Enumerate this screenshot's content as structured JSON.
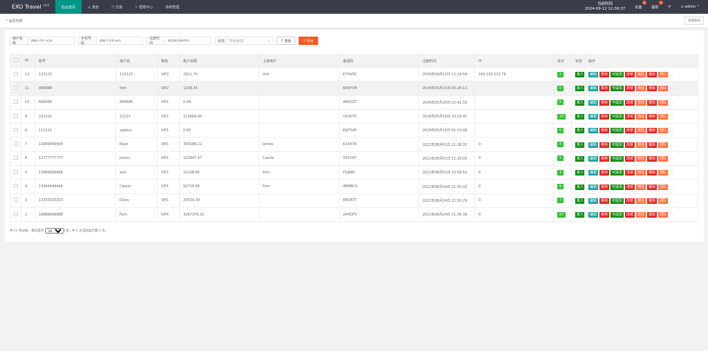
{
  "header": {
    "logo": "EXO Travel",
    "version": "v1.0",
    "nav": [
      "后台首页",
      "角色",
      "交易",
      "帮助中心",
      "系统管理"
    ],
    "time_label": "当前时间",
    "time": "2024-09-12 12:36:37",
    "recharge": "充值",
    "recharge_badge": "0",
    "withdraw": "提现",
    "withdraw_badge": "0",
    "user": "admin"
  },
  "breadcrumb": "会员列表",
  "add_member": "添加会员",
  "filters": {
    "username_label": "用户名称",
    "username_ph": "请输入用户名称",
    "phone_label": "手机号码",
    "phone_ph": "请输入手机号码",
    "reg_label": "注册时间",
    "reg_ph": "请选择注册时间",
    "status_label": "状态",
    "status_value": "所有状态",
    "search": "搜索",
    "export": "导出"
  },
  "columns": [
    "ID",
    "账号",
    "用户名",
    "等级",
    "账户余额",
    "上级用户",
    "邀请码",
    "注册时间",
    "ip",
    "单日",
    "状态",
    "操作"
  ],
  "actions": [
    "编辑",
    "禁用",
    "可提现",
    "改银",
    "地址",
    "删除",
    "团队",
    "..."
  ],
  "action_colors": [
    "#1e9fa0",
    "#e0201c",
    "#108b10",
    "#e0201c",
    "#ff6f3c",
    "#e0201c",
    "#ff6f3c"
  ],
  "status_text": "真人",
  "rows": [
    [
      "12",
      "123123",
      "123123",
      "VIP2",
      "2911.70",
      "ttttt",
      "E7HVRC",
      "2024年09月12日 12:24:54",
      "169.150.222.76",
      "2"
    ],
    [
      "11",
      "888888",
      "ttttt",
      "VIP2",
      "1238.34",
      "",
      "BX9YVN",
      "2024年05月21日 00:28:11",
      "",
      "0"
    ],
    [
      "10",
      "666666",
      "666666",
      "VIP1",
      "0.00",
      "",
      "ABVGZT",
      "2024年05月20日 02:42:32",
      "",
      "0"
    ],
    [
      "9",
      "222222",
      "22222",
      "VIP1",
      "115869.00",
      "",
      "U53XTK",
      "2024年05月19日 23:16:41",
      "",
      "29"
    ],
    [
      "8",
      "111111",
      "aabbcc",
      "VIP1",
      "0.00",
      "",
      "EJDTUM",
      "2024年05月19日 01:15:09",
      "",
      "0"
    ],
    [
      "7",
      "13999999999",
      "Ryan",
      "VIP1",
      "305088.22",
      "James",
      "K3X47A",
      "2022年08月01日 11:28:35",
      "0",
      "4"
    ],
    [
      "6",
      "13777777777",
      "James",
      "VIP1",
      "102847.47",
      "Cassie",
      "V553A7",
      "2022年08月01日 11:25:05",
      "0",
      "5"
    ],
    [
      "5",
      "13666666666",
      "ailsi",
      "VIP1",
      "10108.83",
      "Fern",
      "FDJ68C",
      "2022年08月01日 10:59:52",
      "0",
      "3"
    ],
    [
      "4",
      "13444444444",
      "Cassie",
      "VIP1",
      "52716.89",
      "Fern",
      "4M9BCA",
      "2022年08月24日 21:55:02",
      "0",
      "8"
    ],
    [
      "3",
      "13333333333",
      "Daisy",
      "VIP1",
      "20539.39",
      "",
      "B8QP3T",
      "2022年08月24日 21:50:29",
      "0",
      "7"
    ],
    [
      "2",
      "18888888888",
      "Fern",
      "VIP5",
      "3267376.32",
      "",
      "24HDF5",
      "2022年08月24日 21:26:38",
      "0",
      "67"
    ]
  ],
  "footer": {
    "prefix": "共 11 条记录，每页显示",
    "page_size": "20",
    "suffix": "条，共 1 页当前显示第 1 页。"
  }
}
